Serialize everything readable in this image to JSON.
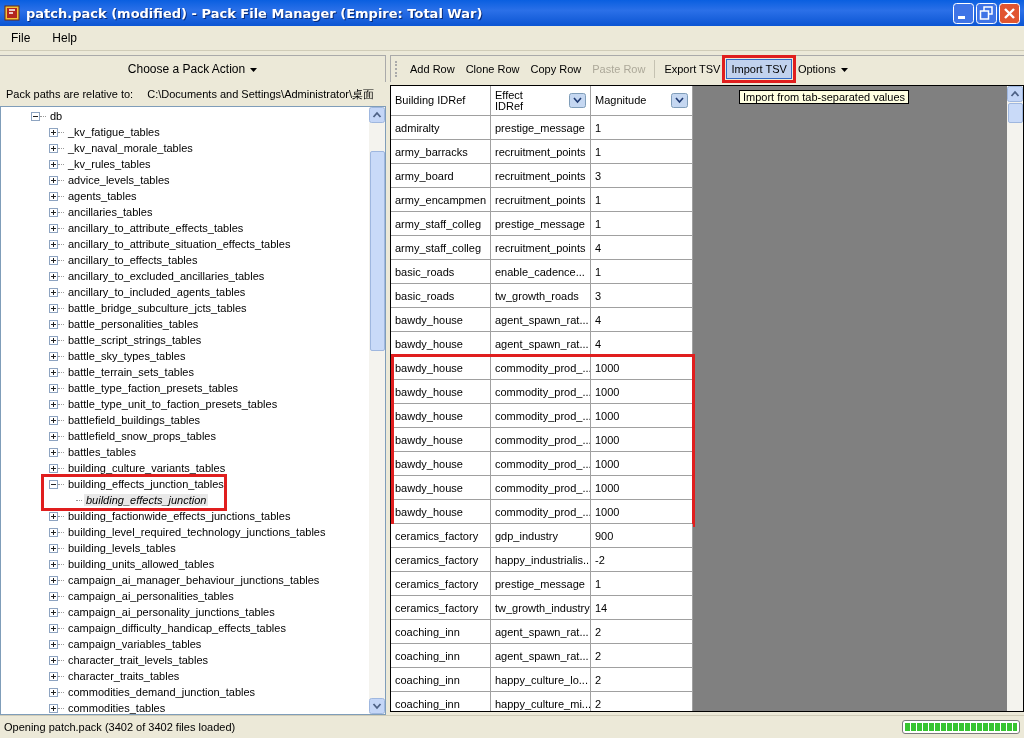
{
  "window": {
    "title": "patch.pack (modified) - Pack File Manager (Empire: Total War)"
  },
  "menu": [
    "File",
    "Help"
  ],
  "left_panel": {
    "action_button": "Choose a Pack Action",
    "path_label": "Pack paths are relative to:",
    "path_value": "C:\\Documents  and Settings\\Administrator\\桌面",
    "tree": [
      {
        "label": "db",
        "expanded": true,
        "selected": false,
        "children": [
          {
            "label": "_kv_fatigue_tables",
            "expanded": false,
            "selected": false
          },
          {
            "label": "_kv_naval_morale_tables",
            "expanded": false,
            "selected": false
          },
          {
            "label": "_kv_rules_tables",
            "expanded": false,
            "selected": false
          },
          {
            "label": "advice_levels_tables",
            "expanded": false,
            "selected": false
          },
          {
            "label": "agents_tables",
            "expanded": false,
            "selected": false
          },
          {
            "label": "ancillaries_tables",
            "expanded": false,
            "selected": false
          },
          {
            "label": "ancillary_to_attribute_effects_tables",
            "expanded": false,
            "selected": false
          },
          {
            "label": "ancillary_to_attribute_situation_effects_tables",
            "expanded": false,
            "selected": false
          },
          {
            "label": "ancillary_to_effects_tables",
            "expanded": false,
            "selected": false
          },
          {
            "label": "ancillary_to_excluded_ancillaries_tables",
            "expanded": false,
            "selected": false
          },
          {
            "label": "ancillary_to_included_agents_tables",
            "expanded": false,
            "selected": false
          },
          {
            "label": "battle_bridge_subculture_jcts_tables",
            "expanded": false,
            "selected": false
          },
          {
            "label": "battle_personalities_tables",
            "expanded": false,
            "selected": false
          },
          {
            "label": "battle_script_strings_tables",
            "expanded": false,
            "selected": false
          },
          {
            "label": "battle_sky_types_tables",
            "expanded": false,
            "selected": false
          },
          {
            "label": "battle_terrain_sets_tables",
            "expanded": false,
            "selected": false
          },
          {
            "label": "battle_type_faction_presets_tables",
            "expanded": false,
            "selected": false
          },
          {
            "label": "battle_type_unit_to_faction_presets_tables",
            "expanded": false,
            "selected": false
          },
          {
            "label": "battlefield_buildings_tables",
            "expanded": false,
            "selected": false
          },
          {
            "label": "battlefield_snow_props_tables",
            "expanded": false,
            "selected": false
          },
          {
            "label": "battles_tables",
            "expanded": false,
            "selected": false
          },
          {
            "label": "building_culture_variants_tables",
            "expanded": false,
            "selected": false
          },
          {
            "label": "building_effects_junction_tables",
            "expanded": true,
            "selected": false,
            "highlighted": true,
            "children": [
              {
                "label": "building_effects_junction",
                "selected": true
              }
            ]
          },
          {
            "label": "building_factionwide_effects_junctions_tables",
            "expanded": false,
            "selected": false
          },
          {
            "label": "building_level_required_technology_junctions_tables",
            "expanded": false,
            "selected": false
          },
          {
            "label": "building_levels_tables",
            "expanded": false,
            "selected": false
          },
          {
            "label": "building_units_allowed_tables",
            "expanded": false,
            "selected": false
          },
          {
            "label": "campaign_ai_manager_behaviour_junctions_tables",
            "expanded": false,
            "selected": false
          },
          {
            "label": "campaign_ai_personalities_tables",
            "expanded": false,
            "selected": false
          },
          {
            "label": "campaign_ai_personality_junctions_tables",
            "expanded": false,
            "selected": false
          },
          {
            "label": "campaign_difficulty_handicap_effects_tables",
            "expanded": false,
            "selected": false
          },
          {
            "label": "campaign_variables_tables",
            "expanded": false,
            "selected": false
          },
          {
            "label": "character_trait_levels_tables",
            "expanded": false,
            "selected": false
          },
          {
            "label": "character_traits_tables",
            "expanded": false,
            "selected": false
          },
          {
            "label": "commodities_demand_junction_tables",
            "expanded": false,
            "selected": false
          },
          {
            "label": "commodities_tables",
            "expanded": false,
            "selected": false
          }
        ]
      }
    ]
  },
  "toolbar": [
    {
      "label": "Add Row",
      "disabled": false,
      "selected": false,
      "highlighted": false
    },
    {
      "label": "Clone Row",
      "disabled": false,
      "selected": false,
      "highlighted": false
    },
    {
      "label": "Copy Row",
      "disabled": false,
      "selected": false,
      "highlighted": false
    },
    {
      "label": "Paste Row",
      "disabled": true,
      "selected": false,
      "highlighted": false
    },
    {
      "kind": "separator"
    },
    {
      "label": "Export TSV",
      "disabled": false,
      "selected": false,
      "highlighted": false
    },
    {
      "label": "Import TSV",
      "disabled": false,
      "selected": true,
      "highlighted": true
    },
    {
      "label": "Options",
      "kind": "dropdown",
      "disabled": false,
      "selected": false,
      "highlighted": false
    }
  ],
  "tooltip": "Import from tab-separated values",
  "table": {
    "columns": [
      {
        "label": "Building IDRef",
        "filter": false
      },
      {
        "label": "Effect IDRef",
        "filter": true
      },
      {
        "label": "Magnitude",
        "filter": true
      }
    ],
    "rows": [
      {
        "cells": [
          "admiralty",
          "prestige_message",
          "1"
        ],
        "highlighted": false
      },
      {
        "cells": [
          "army_barracks",
          "recruitment_points",
          "1"
        ],
        "highlighted": false
      },
      {
        "cells": [
          "army_board",
          "recruitment_points",
          "3"
        ],
        "highlighted": false
      },
      {
        "cells": [
          "army_encampmen",
          "recruitment_points",
          "1"
        ],
        "highlighted": false
      },
      {
        "cells": [
          "army_staff_colleg",
          "prestige_message",
          "1"
        ],
        "highlighted": false
      },
      {
        "cells": [
          "army_staff_colleg",
          "recruitment_points",
          "4"
        ],
        "highlighted": false
      },
      {
        "cells": [
          "basic_roads",
          "enable_cadence...",
          "1"
        ],
        "highlighted": false
      },
      {
        "cells": [
          "basic_roads",
          "tw_growth_roads",
          "3"
        ],
        "highlighted": false
      },
      {
        "cells": [
          "bawdy_house",
          "agent_spawn_rat...",
          "4"
        ],
        "highlighted": false
      },
      {
        "cells": [
          "bawdy_house",
          "agent_spawn_rat...",
          "4"
        ],
        "highlighted": false
      },
      {
        "cells": [
          "bawdy_house",
          "commodity_prod_...",
          "1000"
        ],
        "highlighted": true
      },
      {
        "cells": [
          "bawdy_house",
          "commodity_prod_...",
          "1000"
        ],
        "highlighted": true
      },
      {
        "cells": [
          "bawdy_house",
          "commodity_prod_...",
          "1000"
        ],
        "highlighted": true
      },
      {
        "cells": [
          "bawdy_house",
          "commodity_prod_...",
          "1000"
        ],
        "highlighted": true
      },
      {
        "cells": [
          "bawdy_house",
          "commodity_prod_...",
          "1000"
        ],
        "highlighted": true
      },
      {
        "cells": [
          "bawdy_house",
          "commodity_prod_...",
          "1000"
        ],
        "highlighted": true
      },
      {
        "cells": [
          "bawdy_house",
          "commodity_prod_...",
          "1000"
        ],
        "highlighted": true
      },
      {
        "cells": [
          "ceramics_factory",
          "gdp_industry",
          "900"
        ],
        "highlighted": false
      },
      {
        "cells": [
          "ceramics_factory",
          "happy_industrialis...",
          "-2"
        ],
        "highlighted": false
      },
      {
        "cells": [
          "ceramics_factory",
          "prestige_message",
          "1"
        ],
        "highlighted": false
      },
      {
        "cells": [
          "ceramics_factory",
          "tw_growth_industry",
          "14"
        ],
        "highlighted": false
      },
      {
        "cells": [
          "coaching_inn",
          "agent_spawn_rat...",
          "2"
        ],
        "highlighted": false
      },
      {
        "cells": [
          "coaching_inn",
          "agent_spawn_rat...",
          "2"
        ],
        "highlighted": false
      },
      {
        "cells": [
          "coaching_inn",
          "happy_culture_lo...",
          "2"
        ],
        "highlighted": false
      },
      {
        "cells": [
          "coaching_inn",
          "happy_culture_mi...",
          "2"
        ],
        "highlighted": false
      }
    ]
  },
  "status_bar": {
    "text": "Opening patch.pack (3402 of 3402 files loaded)",
    "progress": {
      "level": 1
    }
  }
}
